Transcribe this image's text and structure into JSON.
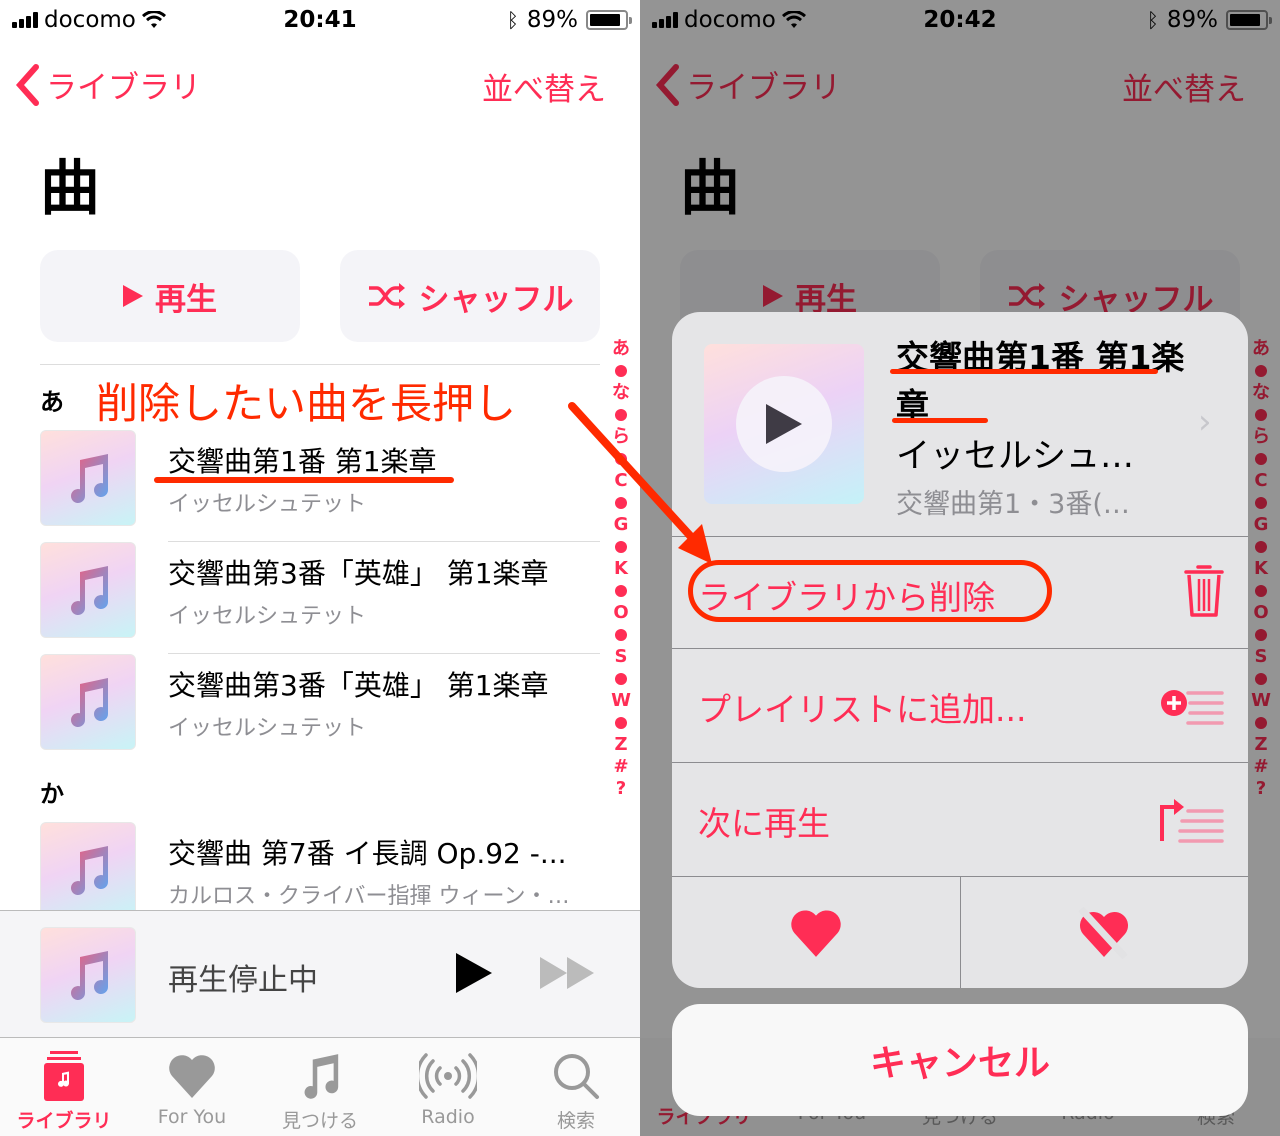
{
  "colors": {
    "accent": "#ff2d55",
    "annotation": "#ff2a00",
    "secondary_text": "#8e8e93"
  },
  "left": {
    "status": {
      "carrier": "docomo",
      "time": "20:41",
      "battery": "89%",
      "battery_level": 0.89
    },
    "nav": {
      "back_label": "ライブラリ",
      "sort_label": "並べ替え"
    },
    "title": "曲",
    "buttons": {
      "play": "再生",
      "shuffle": "シャッフル"
    },
    "sections": [
      {
        "header": "あ",
        "songs": [
          {
            "title": "交響曲第1番 第1楽章",
            "artist": "イッセルシュテット"
          },
          {
            "title": "交響曲第3番「英雄」 第1楽章",
            "artist": "イッセルシュテット"
          },
          {
            "title": "交響曲第3番「英雄」 第1楽章",
            "artist": "イッセルシュテット"
          }
        ]
      },
      {
        "header": "か",
        "songs": [
          {
            "title": "交響曲 第7番 イ長調 Op.92 -...",
            "artist": "カルロス・クライバー指揮 ウィーン・…"
          }
        ]
      }
    ],
    "index": [
      "あ",
      "•",
      "な",
      "•",
      "ら",
      "•",
      "C",
      "•",
      "G",
      "•",
      "K",
      "•",
      "O",
      "•",
      "S",
      "•",
      "W",
      "•",
      "Z",
      "#",
      "?"
    ],
    "mini_player": {
      "status": "再生停止中"
    },
    "tabs": [
      {
        "label": "ライブラリ",
        "icon": "library-icon",
        "active": true
      },
      {
        "label": "For You",
        "icon": "heart-icon",
        "active": false
      },
      {
        "label": "見つける",
        "icon": "music-note-icon",
        "active": false
      },
      {
        "label": "Radio",
        "icon": "radio-icon",
        "active": false
      },
      {
        "label": "検索",
        "icon": "search-icon",
        "active": false
      }
    ],
    "annotation": "削除したい曲を長押し"
  },
  "right": {
    "status": {
      "carrier": "docomo",
      "time": "20:42",
      "battery": "89%",
      "battery_level": 0.89
    },
    "nav": {
      "back_label": "ライブラリ",
      "sort_label": "並べ替え"
    },
    "title": "曲",
    "buttons": {
      "play": "再生",
      "shuffle": "シャッフル"
    },
    "sheet": {
      "song_title": "交響曲第1番 第1楽章",
      "artist": "イッセルシュテット",
      "artist_truncated": "イッセルシュ…",
      "album_truncated": "交響曲第1・3番(…",
      "options": [
        {
          "label": "ライブラリから削除",
          "icon": "trash-icon"
        },
        {
          "label": "プレイリストに追加...",
          "icon": "add-to-playlist-icon"
        },
        {
          "label": "次に再生",
          "icon": "play-next-icon"
        }
      ],
      "love_icon": "heart-icon",
      "dislike_icon": "heart-slash-icon",
      "cancel": "キャンセル"
    }
  }
}
